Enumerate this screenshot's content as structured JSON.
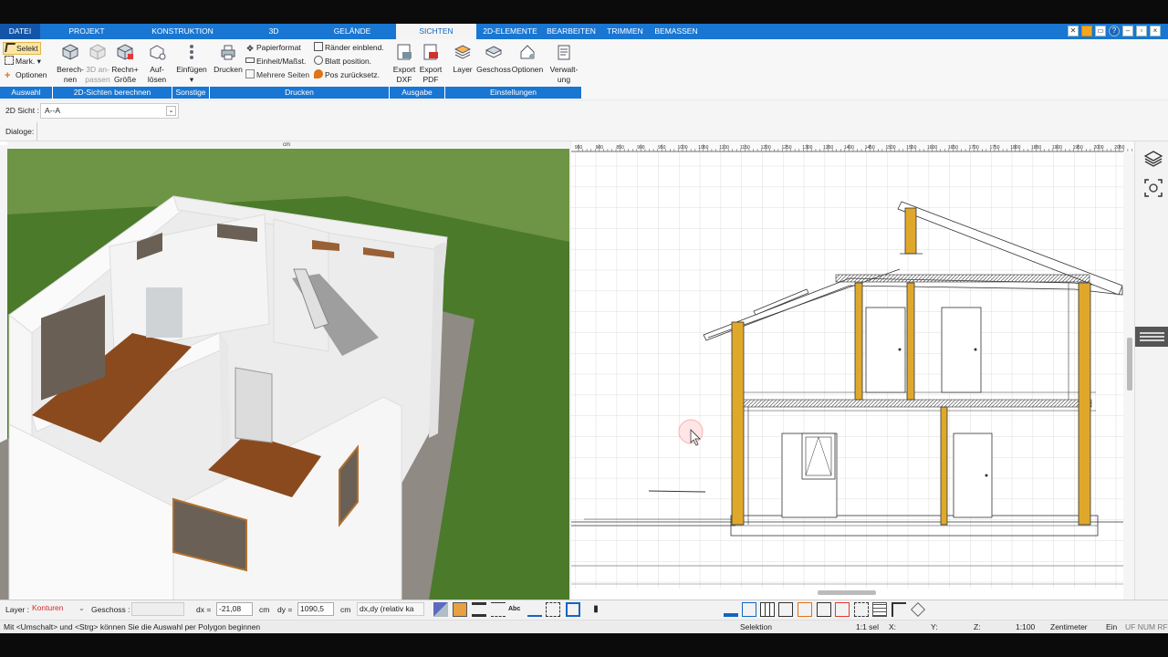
{
  "tabs": [
    {
      "label": "DATEI",
      "active": false
    },
    {
      "label": "PROJEKT",
      "active": false
    },
    {
      "label": "KONSTRUKTION",
      "active": false
    },
    {
      "label": "3D",
      "active": false
    },
    {
      "label": "GELÄNDE",
      "active": false
    },
    {
      "label": "SICHTEN",
      "active": true
    },
    {
      "label": "2D-ELEMENTE",
      "active": false
    },
    {
      "label": "BEARBEITEN",
      "active": false
    },
    {
      "label": "TRIMMEN",
      "active": false
    },
    {
      "label": "BEMASSEN",
      "active": false
    }
  ],
  "ribbon": {
    "auswahl": {
      "selekt": "Selekt",
      "mark": "Mark.",
      "optionen": "Optionen",
      "group": "Auswahl"
    },
    "sichten": {
      "berechnen_1": "Berech-",
      "berechnen_2": "nen",
      "anpassen_1": "3D an-",
      "anpassen_2": "passen",
      "rechn_1": "Rechn+",
      "rechn_2": "Größe",
      "aufloesen_1": "Auf-",
      "aufloesen_2": "lösen",
      "group": "2D-Sichten berechnen"
    },
    "sonstige": {
      "einfuegen": "Einfügen",
      "group": "Sonstige"
    },
    "drucken": {
      "drucken": "Drucken",
      "papierformat": "Papierformat",
      "einheit": "Einheit/Maßst.",
      "mehrere": "Mehrere Seiten",
      "raender": "Ränder einblend.",
      "blatt": "Blatt position.",
      "pos": "Pos zurücksetz.",
      "group": "Drucken"
    },
    "ausgabe": {
      "dxf_1": "Export",
      "dxf_2": "DXF",
      "pdf_1": "Export",
      "pdf_2": "PDF",
      "group": "Ausgabe"
    },
    "einstellungen": {
      "layer": "Layer",
      "geschoss": "Geschoss",
      "optionen": "Optionen",
      "verwaltung_1": "Verwalt-",
      "verwaltung_2": "ung",
      "group": "Einstellungen"
    }
  },
  "toolbar": {
    "sicht_label": "2D Sicht :",
    "sicht_value": "A--A",
    "dialoge_label": "Dialoge:"
  },
  "view3d": {
    "unit": "cm"
  },
  "view2d": {
    "ruler_ticks": [
      "950",
      "900",
      "850",
      "900",
      "950",
      "1000",
      "1050",
      "1100",
      "1150",
      "1200",
      "1250",
      "1300",
      "1350",
      "1400",
      "1450",
      "1500",
      "1550",
      "1600",
      "1650",
      "1700",
      "1750",
      "1800",
      "1850",
      "1900",
      "1950",
      "2000",
      "2050",
      "2100"
    ]
  },
  "statusbar": {
    "layer_label": "Layer :",
    "layer_value": "Konturen",
    "geschoss_label": "Geschoss :",
    "dx_label": "dx =",
    "dx_value": "-21,08",
    "dx_unit": "cm",
    "dy_label": "dy =",
    "dy_value": "1090,5",
    "dy_unit": "cm",
    "mode_value": "dx,dy (relativ ka"
  },
  "statusline": {
    "hint": "Mit <Umschalt> und <Strg> können Sie die Auswahl per Polygon beginnen",
    "mode": "Selektion",
    "sel": "1:1 sel",
    "x": "X:",
    "y": "Y:",
    "z": "Z:",
    "scale": "1:100",
    "unit": "Zentimeter",
    "ein": "Ein",
    "flags": "UF NUM RF"
  },
  "colors": {
    "accent": "#1976d2",
    "grass": "#4a7a2a",
    "wood": "#8a4a1e",
    "timber": "#e0a82a"
  }
}
